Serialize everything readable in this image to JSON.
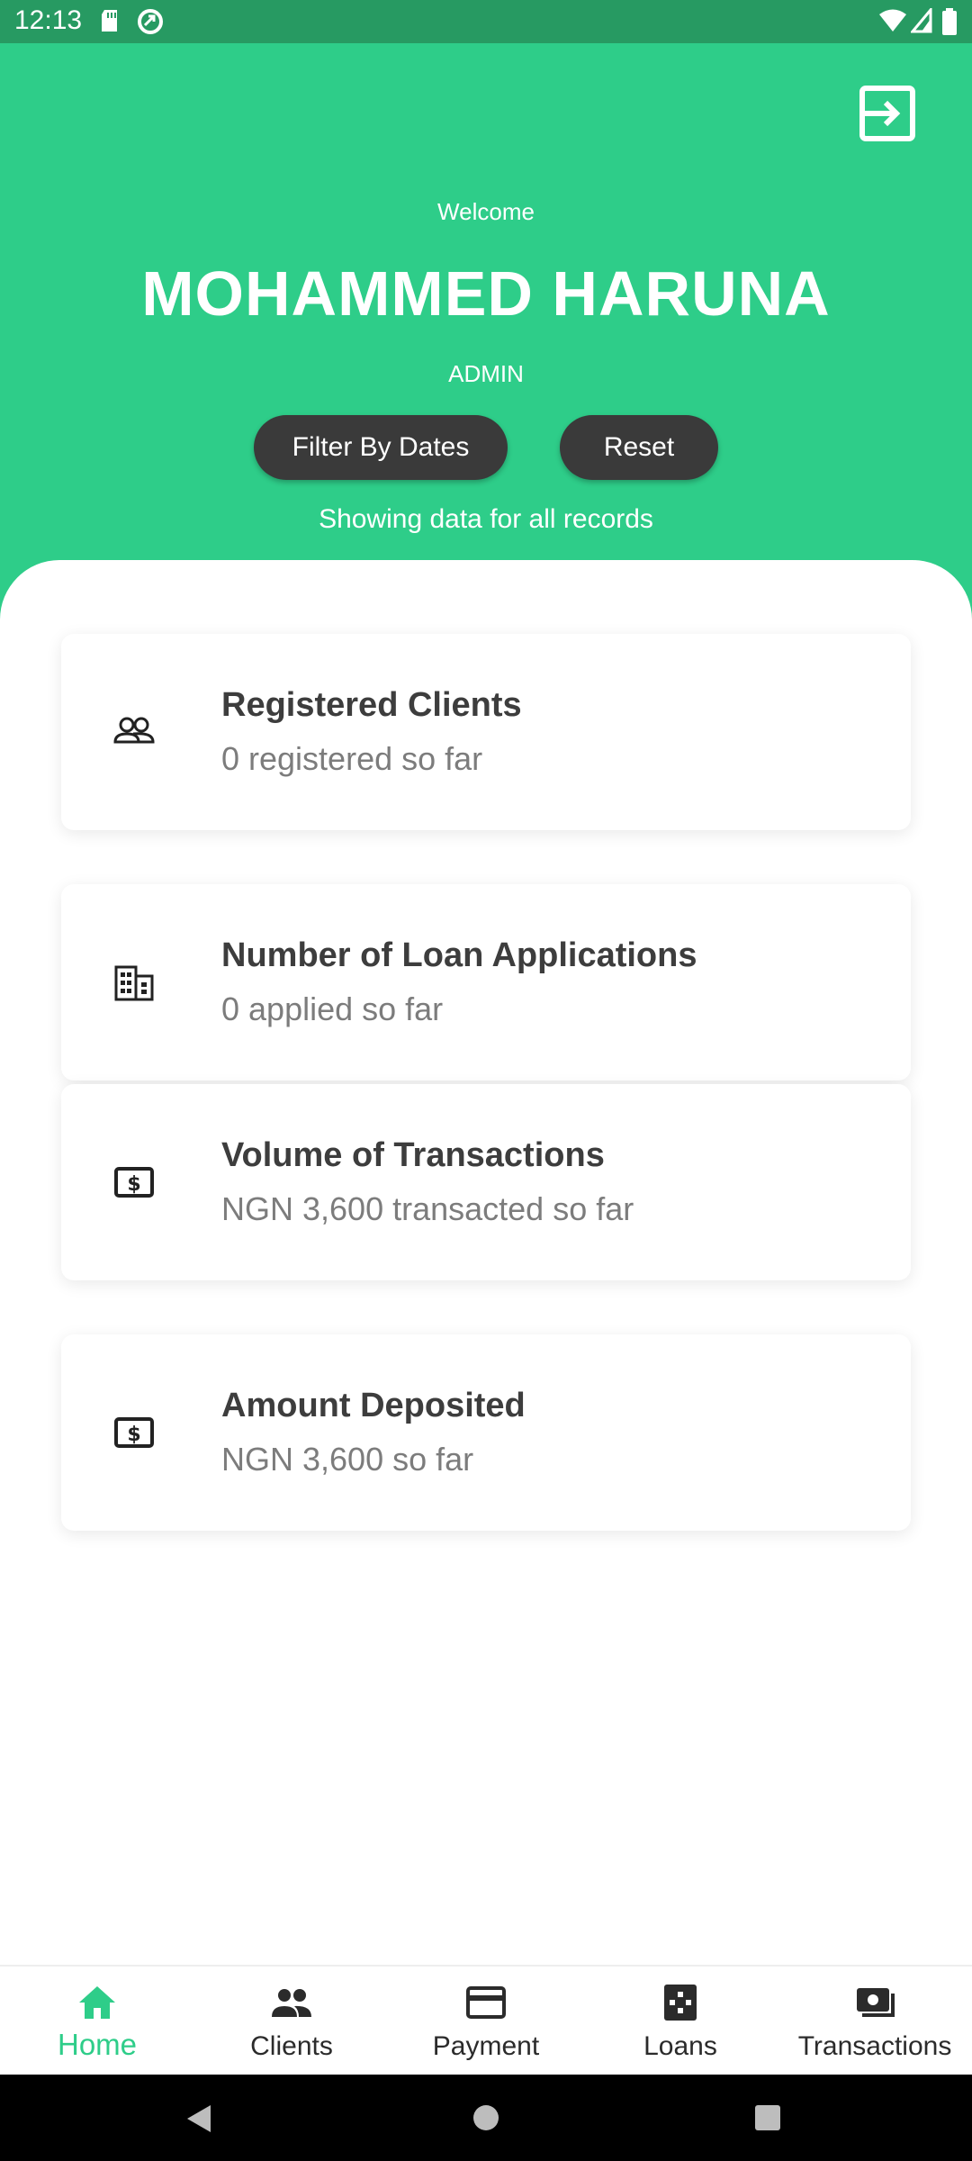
{
  "status_bar": {
    "time": "12:13"
  },
  "header": {
    "welcome": "Welcome",
    "name": "MOHAMMED HARUNA",
    "role": "ADMIN",
    "filter_button": "Filter By Dates",
    "reset_button": "Reset",
    "showing_text": "Showing data for all records",
    "logout_icon": "logout-icon"
  },
  "cards": [
    {
      "icon": "people-icon",
      "title": "Registered Clients",
      "subtitle": "0 registered so far"
    },
    {
      "icon": "building-icon",
      "title": "Number of Loan Applications",
      "subtitle": "0 applied so far"
    },
    {
      "icon": "dollar-icon",
      "title": "Volume of Transactions",
      "subtitle": "NGN 3,600 transacted so far"
    },
    {
      "icon": "dollar-icon",
      "title": "Amount Deposited",
      "subtitle": "NGN 3,600 so far"
    }
  ],
  "bottom_nav": [
    {
      "label": "Home",
      "icon": "home-icon",
      "active": true
    },
    {
      "label": "Clients",
      "icon": "clients-icon",
      "active": false
    },
    {
      "label": "Payment",
      "icon": "card-icon",
      "active": false
    },
    {
      "label": "Loans",
      "icon": "loans-icon",
      "active": false
    },
    {
      "label": "Transactions",
      "icon": "cash-icon",
      "active": false
    }
  ],
  "colors": {
    "accent": "#2ecd89",
    "status_bar": "#279a62",
    "button": "#3a3a3a",
    "nav_active": "#2ecd89"
  }
}
